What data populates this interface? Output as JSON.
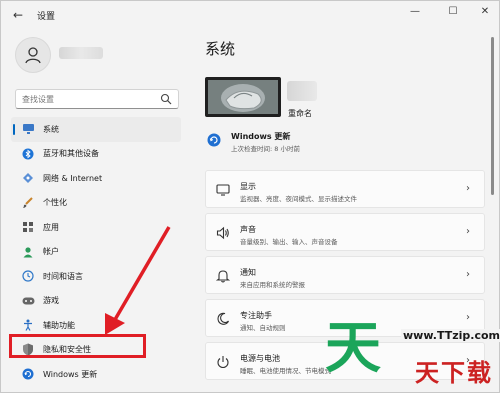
{
  "window": {
    "back_glyph": "←",
    "title": "设置",
    "minimize_glyph": "—",
    "maximize_glyph": "☐",
    "close_glyph": "✕"
  },
  "search": {
    "placeholder": "查找设置",
    "icon": "search-icon"
  },
  "sidebar": {
    "items": [
      {
        "label": "系统",
        "icon": "monitor-icon",
        "active": true
      },
      {
        "label": "蓝牙和其他设备",
        "icon": "bluetooth-icon"
      },
      {
        "label": "网络 & Internet",
        "icon": "network-icon"
      },
      {
        "label": "个性化",
        "icon": "brush-icon"
      },
      {
        "label": "应用",
        "icon": "apps-icon"
      },
      {
        "label": "帐户",
        "icon": "person-icon"
      },
      {
        "label": "时间和语言",
        "icon": "globe-clock-icon"
      },
      {
        "label": "游戏",
        "icon": "gamepad-icon"
      },
      {
        "label": "辅助功能",
        "icon": "accessibility-icon"
      },
      {
        "label": "隐私和安全性",
        "icon": "shield-icon"
      },
      {
        "label": "Windows 更新",
        "icon": "windows-update-icon"
      }
    ]
  },
  "main": {
    "title": "系统",
    "device": {
      "rename_label": "重命名"
    },
    "update": {
      "title": "Windows 更新",
      "subtitle": "上次检查时间: 8 小时前"
    },
    "cards": [
      {
        "title": "显示",
        "subtitle": "监视器、亮度、夜间模式、显示描述文件",
        "icon": "display-icon"
      },
      {
        "title": "声音",
        "subtitle": "音量级别、输出、输入、声音设备",
        "icon": "speaker-icon"
      },
      {
        "title": "通知",
        "subtitle": "来自应用和系统的警报",
        "icon": "bell-icon"
      },
      {
        "title": "专注助手",
        "subtitle": "通知、自动规则",
        "icon": "moon-icon"
      },
      {
        "title": "电源与电池",
        "subtitle": "睡眠、电池使用情况、节电模式",
        "icon": "power-icon"
      }
    ]
  },
  "watermark": {
    "big_char": "天",
    "url": "www.TTzip.com",
    "cn_text": "天下载"
  },
  "colors": {
    "accent": "#0067c0",
    "highlight_red": "#e01e25",
    "watermark_green": "#1ba55a"
  }
}
